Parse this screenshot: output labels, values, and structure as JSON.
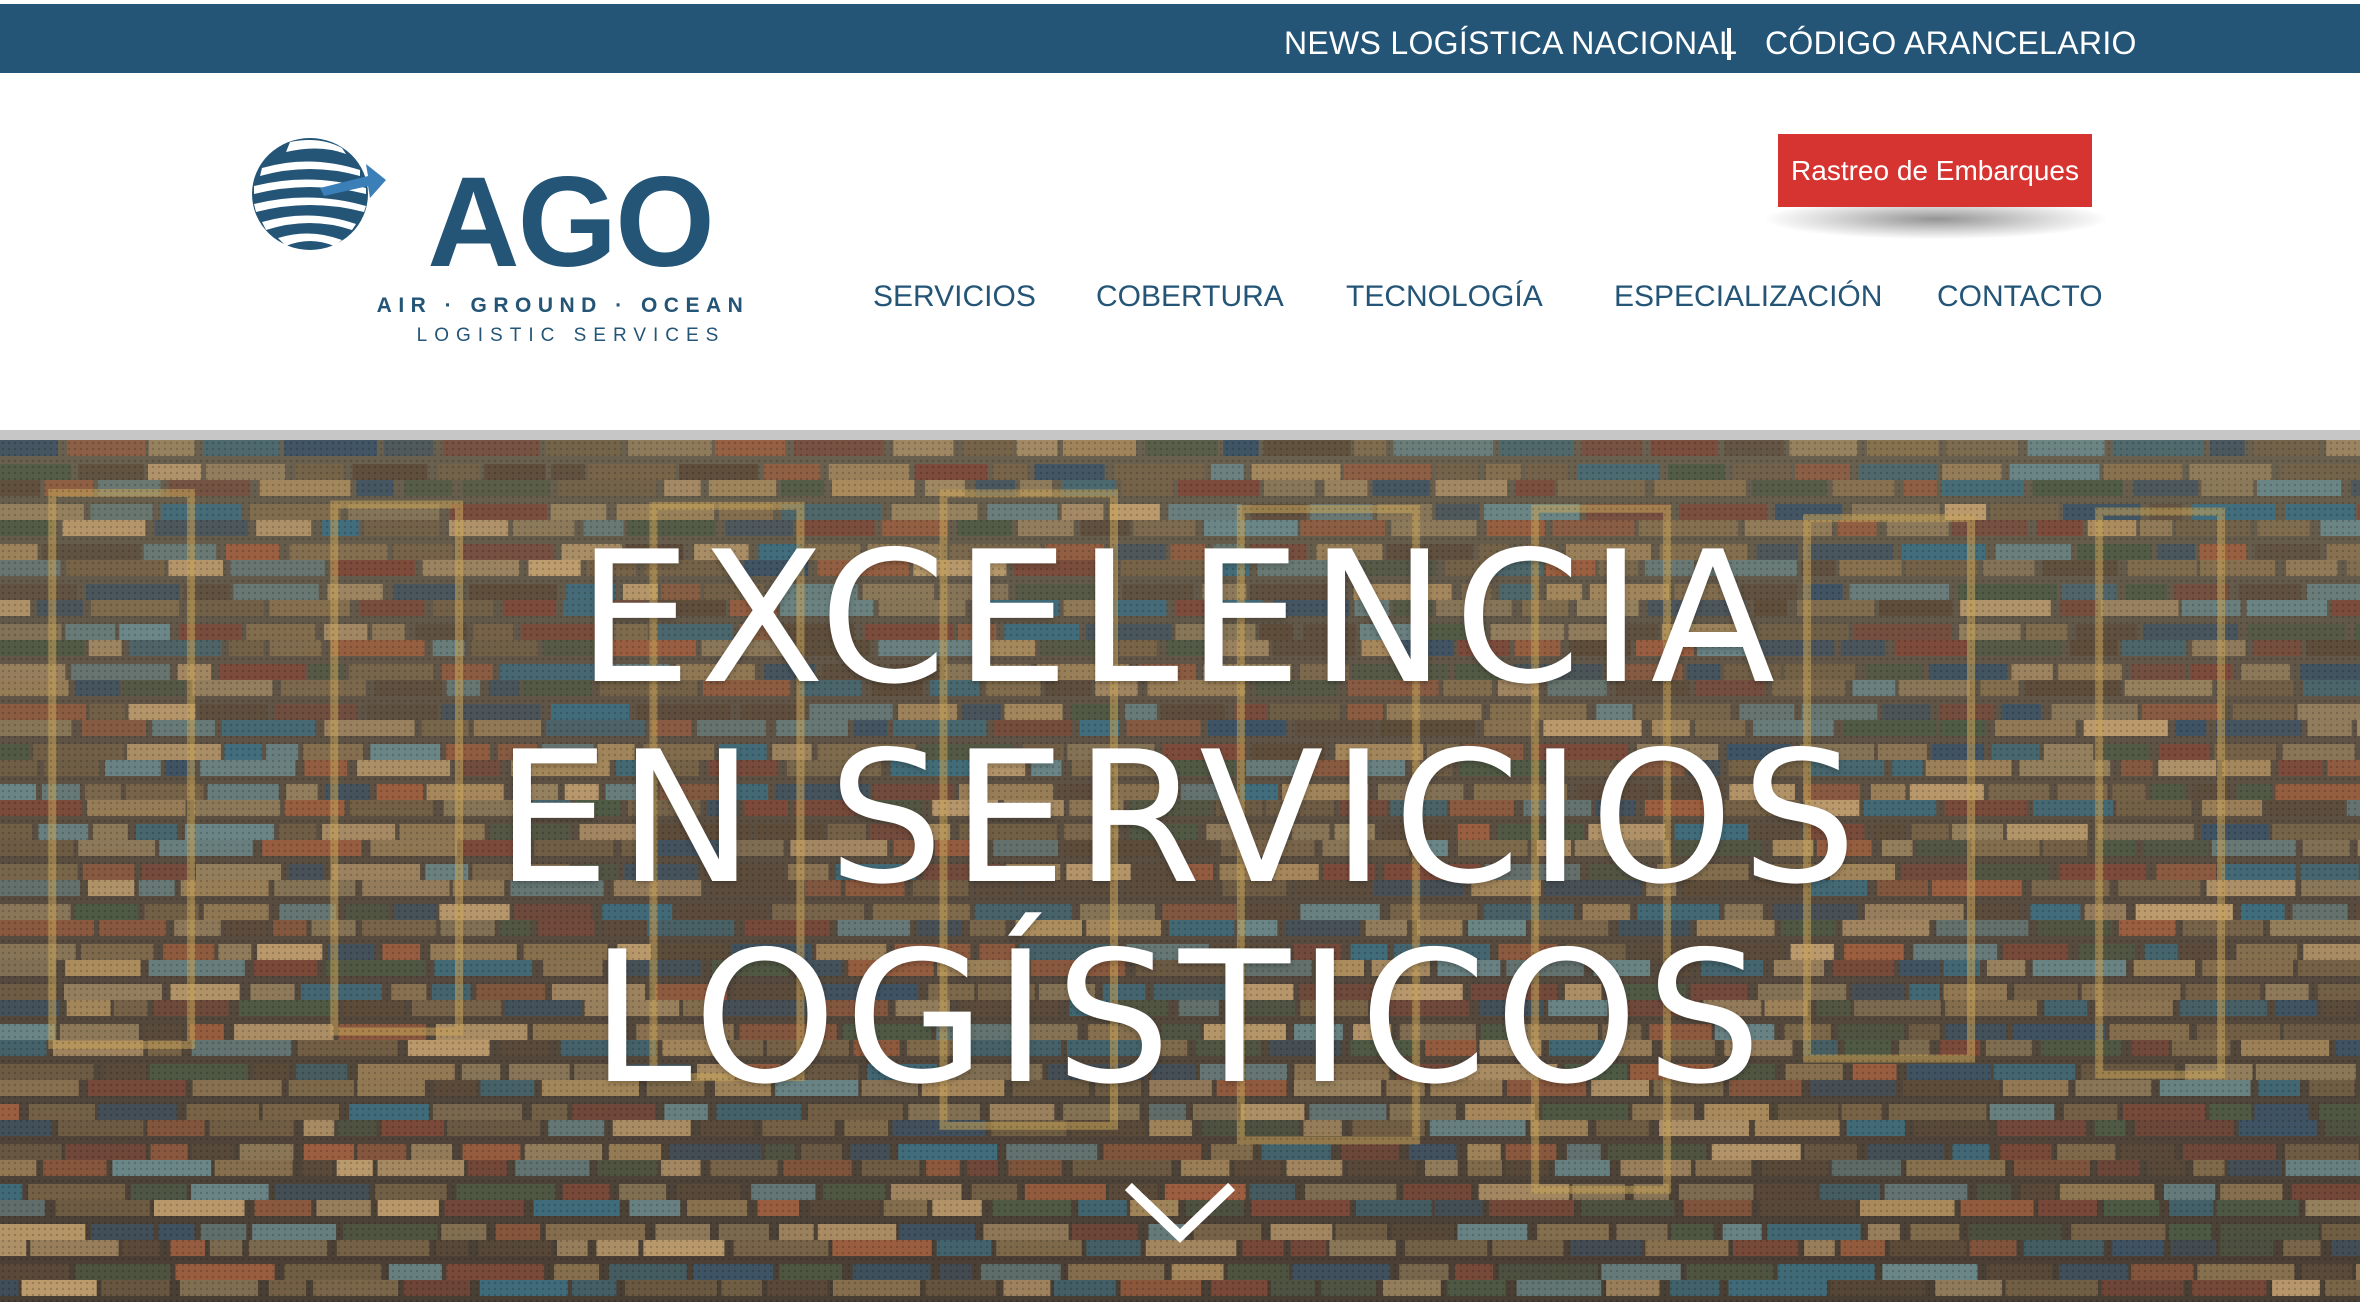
{
  "topbar": {
    "news_link": "NEWS LOGÍSTICA NACIONAL",
    "code_link": "CÓDIGO ARANCELARIO"
  },
  "logo": {
    "name": "AGO",
    "tagline": "AIR · GROUND · OCEAN",
    "subtitle": "LOGISTIC SERVICES",
    "icon": "globe-arrow-icon"
  },
  "tracking_button": "Rastreo de Embarques",
  "nav": [
    {
      "label": "SERVICIOS"
    },
    {
      "label": "COBERTURA"
    },
    {
      "label": "TECNOLOGÍA"
    },
    {
      "label": "ESPECIALIZACIÓN"
    },
    {
      "label": "CONTACTO"
    }
  ],
  "hero": {
    "title_lines": [
      "EXCELENCIA",
      "EN SERVICIOS",
      "LOGÍSTICOS"
    ],
    "background": "container-port-photo",
    "scroll_icon": "chevron-down-icon"
  },
  "colors": {
    "brand_blue": "#245577",
    "accent_red": "#d63431"
  }
}
